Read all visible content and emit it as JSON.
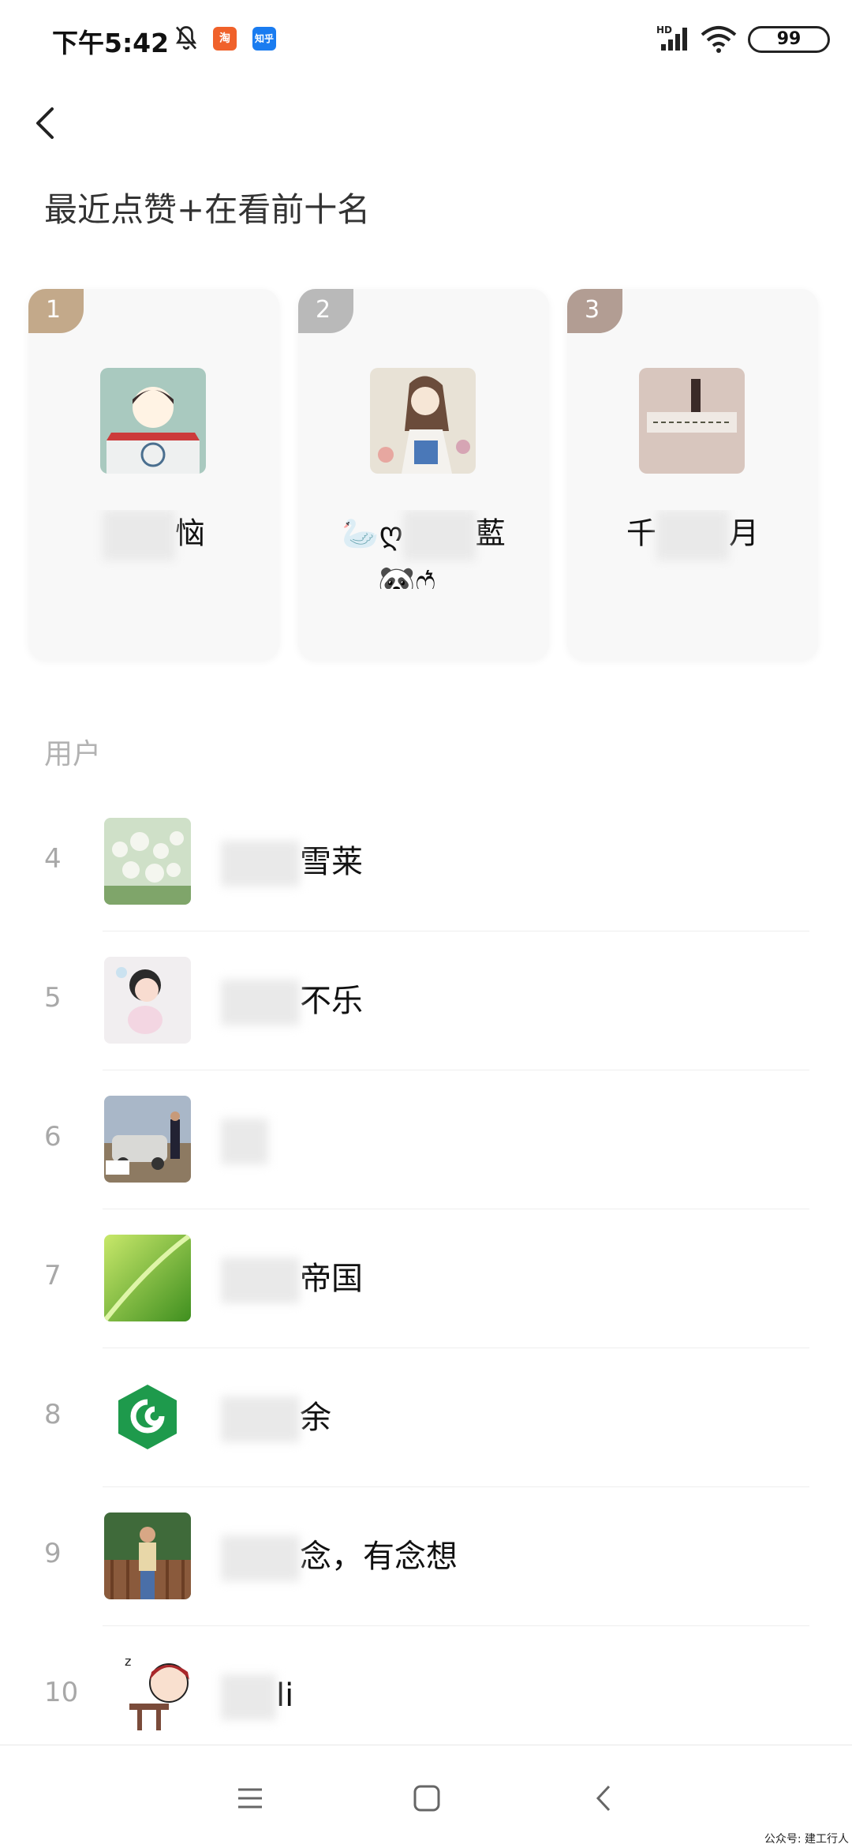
{
  "status_bar": {
    "time": "下午5:42",
    "app_icon_1": "淘",
    "app_icon_2": "知乎",
    "network": "HD",
    "battery": "99"
  },
  "page": {
    "title": "最近点赞+在看前十名",
    "back_icon": "chevron-left-icon"
  },
  "top3": [
    {
      "rank": "1",
      "name_prefix": "",
      "name_suffix": "恼"
    },
    {
      "rank": "2",
      "name_prefix": "🦢ღ",
      "name_suffix": "藍",
      "name_line2": "🐼ෆ͙͛ ‿"
    },
    {
      "rank": "3",
      "name_prefix": "千",
      "name_suffix": "月"
    }
  ],
  "section_label": "用户",
  "users": [
    {
      "rank": "4",
      "name": "雪莱"
    },
    {
      "rank": "5",
      "name": "不乐"
    },
    {
      "rank": "6",
      "name": ""
    },
    {
      "rank": "7",
      "name": "帝国"
    },
    {
      "rank": "8",
      "name": "余"
    },
    {
      "rank": "9",
      "name": "念，有念想"
    },
    {
      "rank": "10",
      "name": "li"
    }
  ],
  "nav": {
    "menu_icon": "menu-icon",
    "home_icon": "square-home-icon",
    "back_icon": "triangle-back-icon"
  },
  "watermark": "公众号: 建工行人",
  "colors": {
    "gold": "#c3a98a",
    "silver": "#b9b9b9",
    "bronze": "#b29d93"
  }
}
